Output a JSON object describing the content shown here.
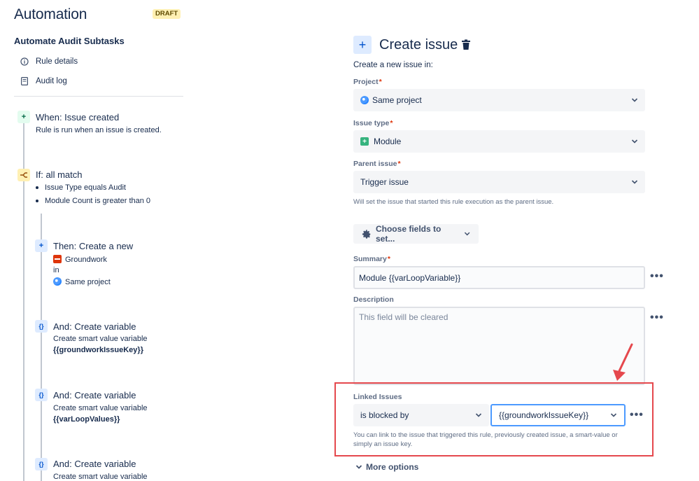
{
  "header": {
    "title": "Automation",
    "badge": "DRAFT"
  },
  "sidebar": {
    "rule_name": "Automate Audit Subtasks",
    "items": [
      {
        "label": "Rule details",
        "icon": "info-icon"
      },
      {
        "label": "Audit log",
        "icon": "document-icon"
      }
    ]
  },
  "flow": {
    "trigger": {
      "title": "When: Issue created",
      "desc": "Rule is run when an issue is created."
    },
    "condition": {
      "title": "If: all match",
      "bullets": [
        "Issue Type equals Audit",
        "Module Count is greater than 0"
      ]
    },
    "create_action": {
      "title": "Then: Create a new",
      "issue_type": "Groundwork",
      "in_label": "in",
      "project": "Same project"
    },
    "variables": [
      {
        "title": "And: Create variable",
        "desc": "Create smart value variable",
        "value": "{{groundworkIssueKey}}"
      },
      {
        "title": "And: Create variable",
        "desc": "Create smart value variable",
        "value": "{{varLoopValues}}"
      },
      {
        "title": "And: Create variable",
        "desc": "Create smart value variable"
      }
    ]
  },
  "panel": {
    "title": "Create issue",
    "subtitle": "Create a new issue in:",
    "project": {
      "label": "Project",
      "value": "Same project"
    },
    "issue_type": {
      "label": "Issue type",
      "value": "Module"
    },
    "parent_issue": {
      "label": "Parent issue",
      "value": "Trigger issue",
      "help": "Will set the issue that started this rule execution as the parent issue."
    },
    "choose_fields_label": "Choose fields to set...",
    "summary": {
      "label": "Summary",
      "value": "Module {{varLoopVariable}}"
    },
    "description": {
      "label": "Description",
      "placeholder": "This field will be cleared"
    },
    "linked_issues": {
      "label": "Linked Issues",
      "link_type": "is blocked by",
      "issue_key": "{{groundworkIssueKey}}",
      "help_line1": "You can link to the issue that triggered this rule, previously created issue, a smart-value or",
      "help_line2": "simply an issue key."
    },
    "more_options_label": "More options",
    "more_dots": "•••",
    "required_mark": "*"
  },
  "colors": {
    "accent": "#0052cc",
    "annotation": "#e5484d",
    "draft_bg": "#fff0b3"
  }
}
